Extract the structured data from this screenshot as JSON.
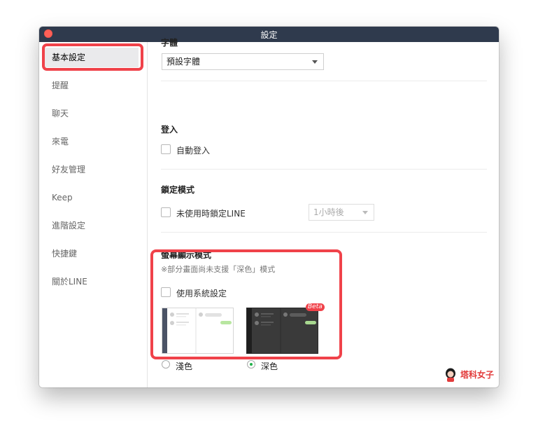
{
  "window": {
    "title": "設定"
  },
  "sidebar": {
    "items": [
      {
        "label": "基本設定",
        "selected": true
      },
      {
        "label": "提醒"
      },
      {
        "label": "聊天"
      },
      {
        "label": "來電"
      },
      {
        "label": "好友管理"
      },
      {
        "label": "Keep"
      },
      {
        "label": "進階設定"
      },
      {
        "label": "快捷鍵"
      },
      {
        "label": "關於LINE"
      }
    ]
  },
  "font": {
    "section_title_partial": "字體",
    "selected": "預設字體"
  },
  "login": {
    "title": "登入",
    "auto_login_label": "自動登入",
    "auto_login_checked": false
  },
  "lock": {
    "title": "鎖定模式",
    "lock_label": "未使用時鎖定LINE",
    "lock_checked": false,
    "duration_selected": "1小時後"
  },
  "display": {
    "title": "螢幕顯示模式",
    "note": "※部分畫面尚未支援「深色」模式",
    "system_label": "使用系統設定",
    "system_checked": false,
    "light_label": "淺色",
    "dark_label": "深色",
    "beta_label": "Beta",
    "selected": "dark"
  },
  "watermark": {
    "text": "塔科女子"
  },
  "colors": {
    "highlight": "#f0424a",
    "titlebar": "#2f3a4d",
    "radio_selected": "#21b14b"
  }
}
